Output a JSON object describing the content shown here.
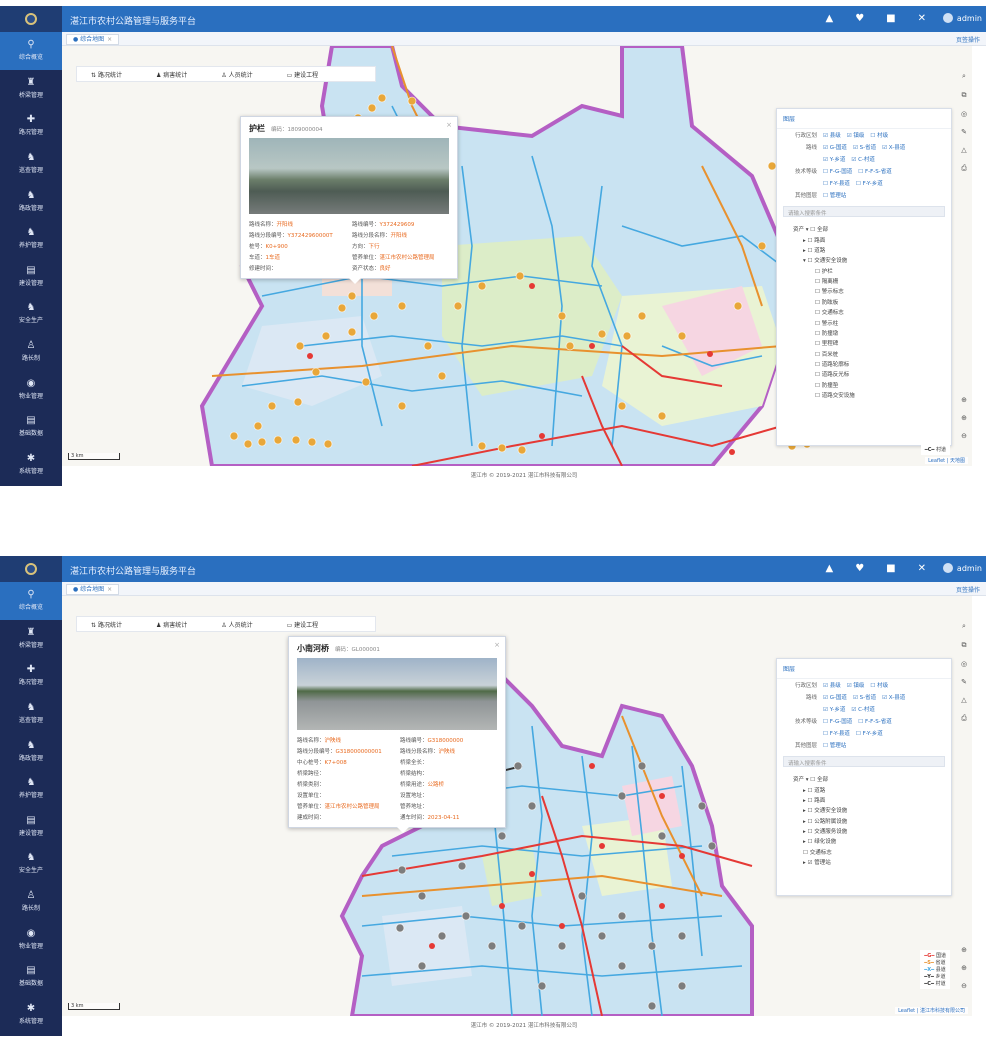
{
  "app": {
    "title": "湛江市农村公路管理与服务平台",
    "user": "admin",
    "footer": "湛江市 © 2019-2021 湛江市科技有限公司"
  },
  "sidebar": [
    {
      "label": "综合概览",
      "icon": "map-pin-icon"
    },
    {
      "label": "桥梁管理",
      "icon": "bridge-icon"
    },
    {
      "label": "路况管理",
      "icon": "road-icon"
    },
    {
      "label": "巡查管理",
      "icon": "patrol-icon"
    },
    {
      "label": "路政管理",
      "icon": "admin-icon"
    },
    {
      "label": "养护管理",
      "icon": "maintenance-icon"
    },
    {
      "label": "建设管理",
      "icon": "build-icon"
    },
    {
      "label": "安全生产",
      "icon": "safety-icon"
    },
    {
      "label": "路长制",
      "icon": "person-icon"
    },
    {
      "label": "物业管理",
      "icon": "globe-icon"
    },
    {
      "label": "基础数据",
      "icon": "data-icon"
    },
    {
      "label": "系统管理",
      "icon": "gear-icon"
    }
  ],
  "tabs": {
    "active": "综合地图",
    "close_ops": "页签操作"
  },
  "stats": [
    "路况统计",
    "病害统计",
    "人员统计",
    "建设工程"
  ],
  "panel": {
    "title": "图层",
    "admin_label": "行政区划",
    "admin_opts": [
      "县级",
      "镇级",
      "村级"
    ],
    "road_label": "路线",
    "road_opts": [
      "G-国道",
      "S-省道",
      "X-县道",
      "Y-乡道",
      "C-村道"
    ],
    "tech_label": "技术等级",
    "tech_opts": [
      "F-G-国道",
      "F-F-S-省道",
      "F-Y-县道",
      "F-Y-乡道",
      "F-C-村道"
    ],
    "other_label": "其他图层",
    "other_opts": [
      "管理站"
    ],
    "select_placeholder": "请输入搜索条件",
    "tree_root": "资产",
    "tree_all": "全部"
  },
  "shot1": {
    "popup": {
      "name": "护栏",
      "code": "编码：1809000004",
      "rows": [
        [
          "路线名称",
          "开阳线",
          "路线编号",
          "Y372429609"
        ],
        [
          "路线分段编号",
          "Y37242960000T",
          "路线分段名称",
          "开阳线"
        ],
        [
          "桩号",
          "K0+900",
          "方向",
          "下行"
        ],
        [
          "车道",
          "1车道",
          "管养单位",
          "湛江市农村公路管理局"
        ],
        [
          "修建时间",
          "",
          "资产状态",
          "良好"
        ]
      ]
    },
    "tree": [
      "路面",
      "道路",
      "交通安全设施",
      "护栏",
      "隔离栅",
      "警示标志",
      "防眩板",
      "交通标志",
      "警示柱",
      "防撞墩",
      "里程碑",
      "百米桩",
      "道路轮廓标",
      "道路反光标",
      "防撞垫",
      "道路交安设施"
    ],
    "legend": [
      "村道"
    ],
    "scale": "3 km",
    "attribution": "Leaflet | 天地图"
  },
  "shot2": {
    "popup": {
      "name": "小南河桥",
      "code": "编码：GL000001",
      "rows": [
        [
          "路线名称",
          "沪陕线",
          "路线编号",
          "G318000000"
        ],
        [
          "路线分段编号",
          "G318000000001",
          "路线分段名称",
          "沪陕线"
        ],
        [
          "中心桩号",
          "K7+008",
          "桥梁全长",
          ""
        ],
        [
          "桥梁跨径",
          "",
          "桥梁结构",
          ""
        ],
        [
          "桥梁类别",
          "",
          "桥梁用途",
          "公路桥"
        ],
        [
          "设置单位",
          "",
          "设置地址",
          ""
        ],
        [
          "管养单位",
          "湛江市农村公路管理局",
          "管养地址",
          ""
        ],
        [
          "建成时间",
          "",
          "通车时间",
          "2023-04-11"
        ]
      ]
    },
    "tree": [
      "道路",
      "路面",
      "交通安全设施",
      "公路附属设施",
      "交通服务设施",
      "绿化设施",
      "交通标志",
      "管理站"
    ],
    "legend": [
      "国道",
      "省道",
      "县道",
      "乡道",
      "村道"
    ],
    "scale": "3 km",
    "attribution": "Leaflet | 湛江市科技有限公司"
  },
  "colors": {
    "header": "#2a6fbf",
    "sidebar": "#1c2b57",
    "national_road": "#e53935",
    "provincial_road": "#e8912e",
    "county_road": "#45a8e0",
    "village_road": "#333333",
    "boundary": "#b45fc4",
    "accent_text": "#e8691e"
  }
}
